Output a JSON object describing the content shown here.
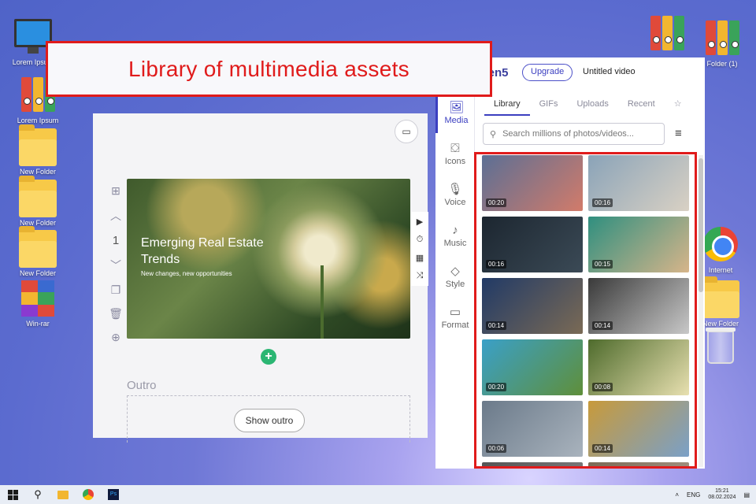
{
  "desktop": {
    "left_icons": [
      {
        "label": "Lorem Ipsum",
        "icon": "computer-icon"
      },
      {
        "label": "Lorem Ipsum",
        "icon": "binders-icon"
      },
      {
        "label": "New Folder",
        "icon": "folder-icon"
      },
      {
        "label": "New Folder",
        "icon": "folder-icon"
      },
      {
        "label": "New Folder",
        "icon": "folder-icon"
      },
      {
        "label": "Win-rar",
        "icon": "winrar-icon"
      }
    ],
    "right_icons": [
      {
        "label": "",
        "icon": "binders-icon"
      },
      {
        "label": "Folder (1)",
        "icon": "binders-icon"
      },
      {
        "label": "Internet",
        "icon": "chrome-icon"
      },
      {
        "label": "New Folder",
        "icon": "folder-icon"
      },
      {
        "label": "",
        "icon": "recycle-bin-icon"
      }
    ]
  },
  "callout": {
    "text": "Library of multimedia assets",
    "color": "#e01b1b"
  },
  "editor": {
    "scene_number": "1",
    "scene_title": "Emerging Real Estate Trends",
    "scene_subtitle": "New changes, new opportunities",
    "outro_label": "Outro",
    "show_outro_label": "Show outro"
  },
  "lumen": {
    "brand": "lumen5",
    "upgrade_label": "Upgrade",
    "video_title": "Untitled video",
    "accent": "#3b3fc0",
    "nav": [
      {
        "label": "Media",
        "icon": "image-icon",
        "active": true
      },
      {
        "label": "Icons",
        "icon": "shapes-icon"
      },
      {
        "label": "Voice",
        "icon": "microphone-icon"
      },
      {
        "label": "Music",
        "icon": "music-note-icon"
      },
      {
        "label": "Style",
        "icon": "paint-bucket-icon"
      },
      {
        "label": "Format",
        "icon": "aspect-ratio-icon"
      }
    ],
    "tabs": [
      "Library",
      "GIFs",
      "Uploads",
      "Recent"
    ],
    "active_tab": "Library",
    "search_placeholder": "Search millions of photos/videos...",
    "thumbnails": [
      {
        "duration": "00:20",
        "subject": "sunset sky",
        "colors": [
          "#5b6f95",
          "#d27b6a"
        ]
      },
      {
        "duration": "00:16",
        "subject": "woman with phone",
        "colors": [
          "#8aa3b8",
          "#d9d1c4"
        ]
      },
      {
        "duration": "00:16",
        "subject": "rain on glass",
        "colors": [
          "#1c2630",
          "#3b4a56"
        ]
      },
      {
        "duration": "00:15",
        "subject": "beach waves",
        "colors": [
          "#2f8f7f",
          "#d7b58a"
        ]
      },
      {
        "duration": "00:14",
        "subject": "city at dusk",
        "colors": [
          "#213a66",
          "#7a6a55"
        ]
      },
      {
        "duration": "00:14",
        "subject": "man at laptop",
        "colors": [
          "#3a3a3a",
          "#c8c8c8"
        ]
      },
      {
        "duration": "00:20",
        "subject": "river valley",
        "colors": [
          "#3aa0c8",
          "#5f8f3a"
        ]
      },
      {
        "duration": "00:08",
        "subject": "flowers",
        "colors": [
          "#4e6b2c",
          "#e8e0b0"
        ]
      },
      {
        "duration": "00:06",
        "subject": "city street",
        "colors": [
          "#6b7a8a",
          "#a9b3bd"
        ]
      },
      {
        "duration": "00:14",
        "subject": "construction workers",
        "colors": [
          "#c89a3a",
          "#7aa0c8"
        ]
      },
      {
        "duration": "",
        "subject": "partial",
        "colors": [
          "#555555",
          "#888888"
        ]
      },
      {
        "duration": "",
        "subject": "partial",
        "colors": [
          "#7a6a55",
          "#b0a090"
        ]
      }
    ]
  },
  "taskbar": {
    "language": "ENG",
    "time": "15:21",
    "date": "08.02.2024"
  }
}
